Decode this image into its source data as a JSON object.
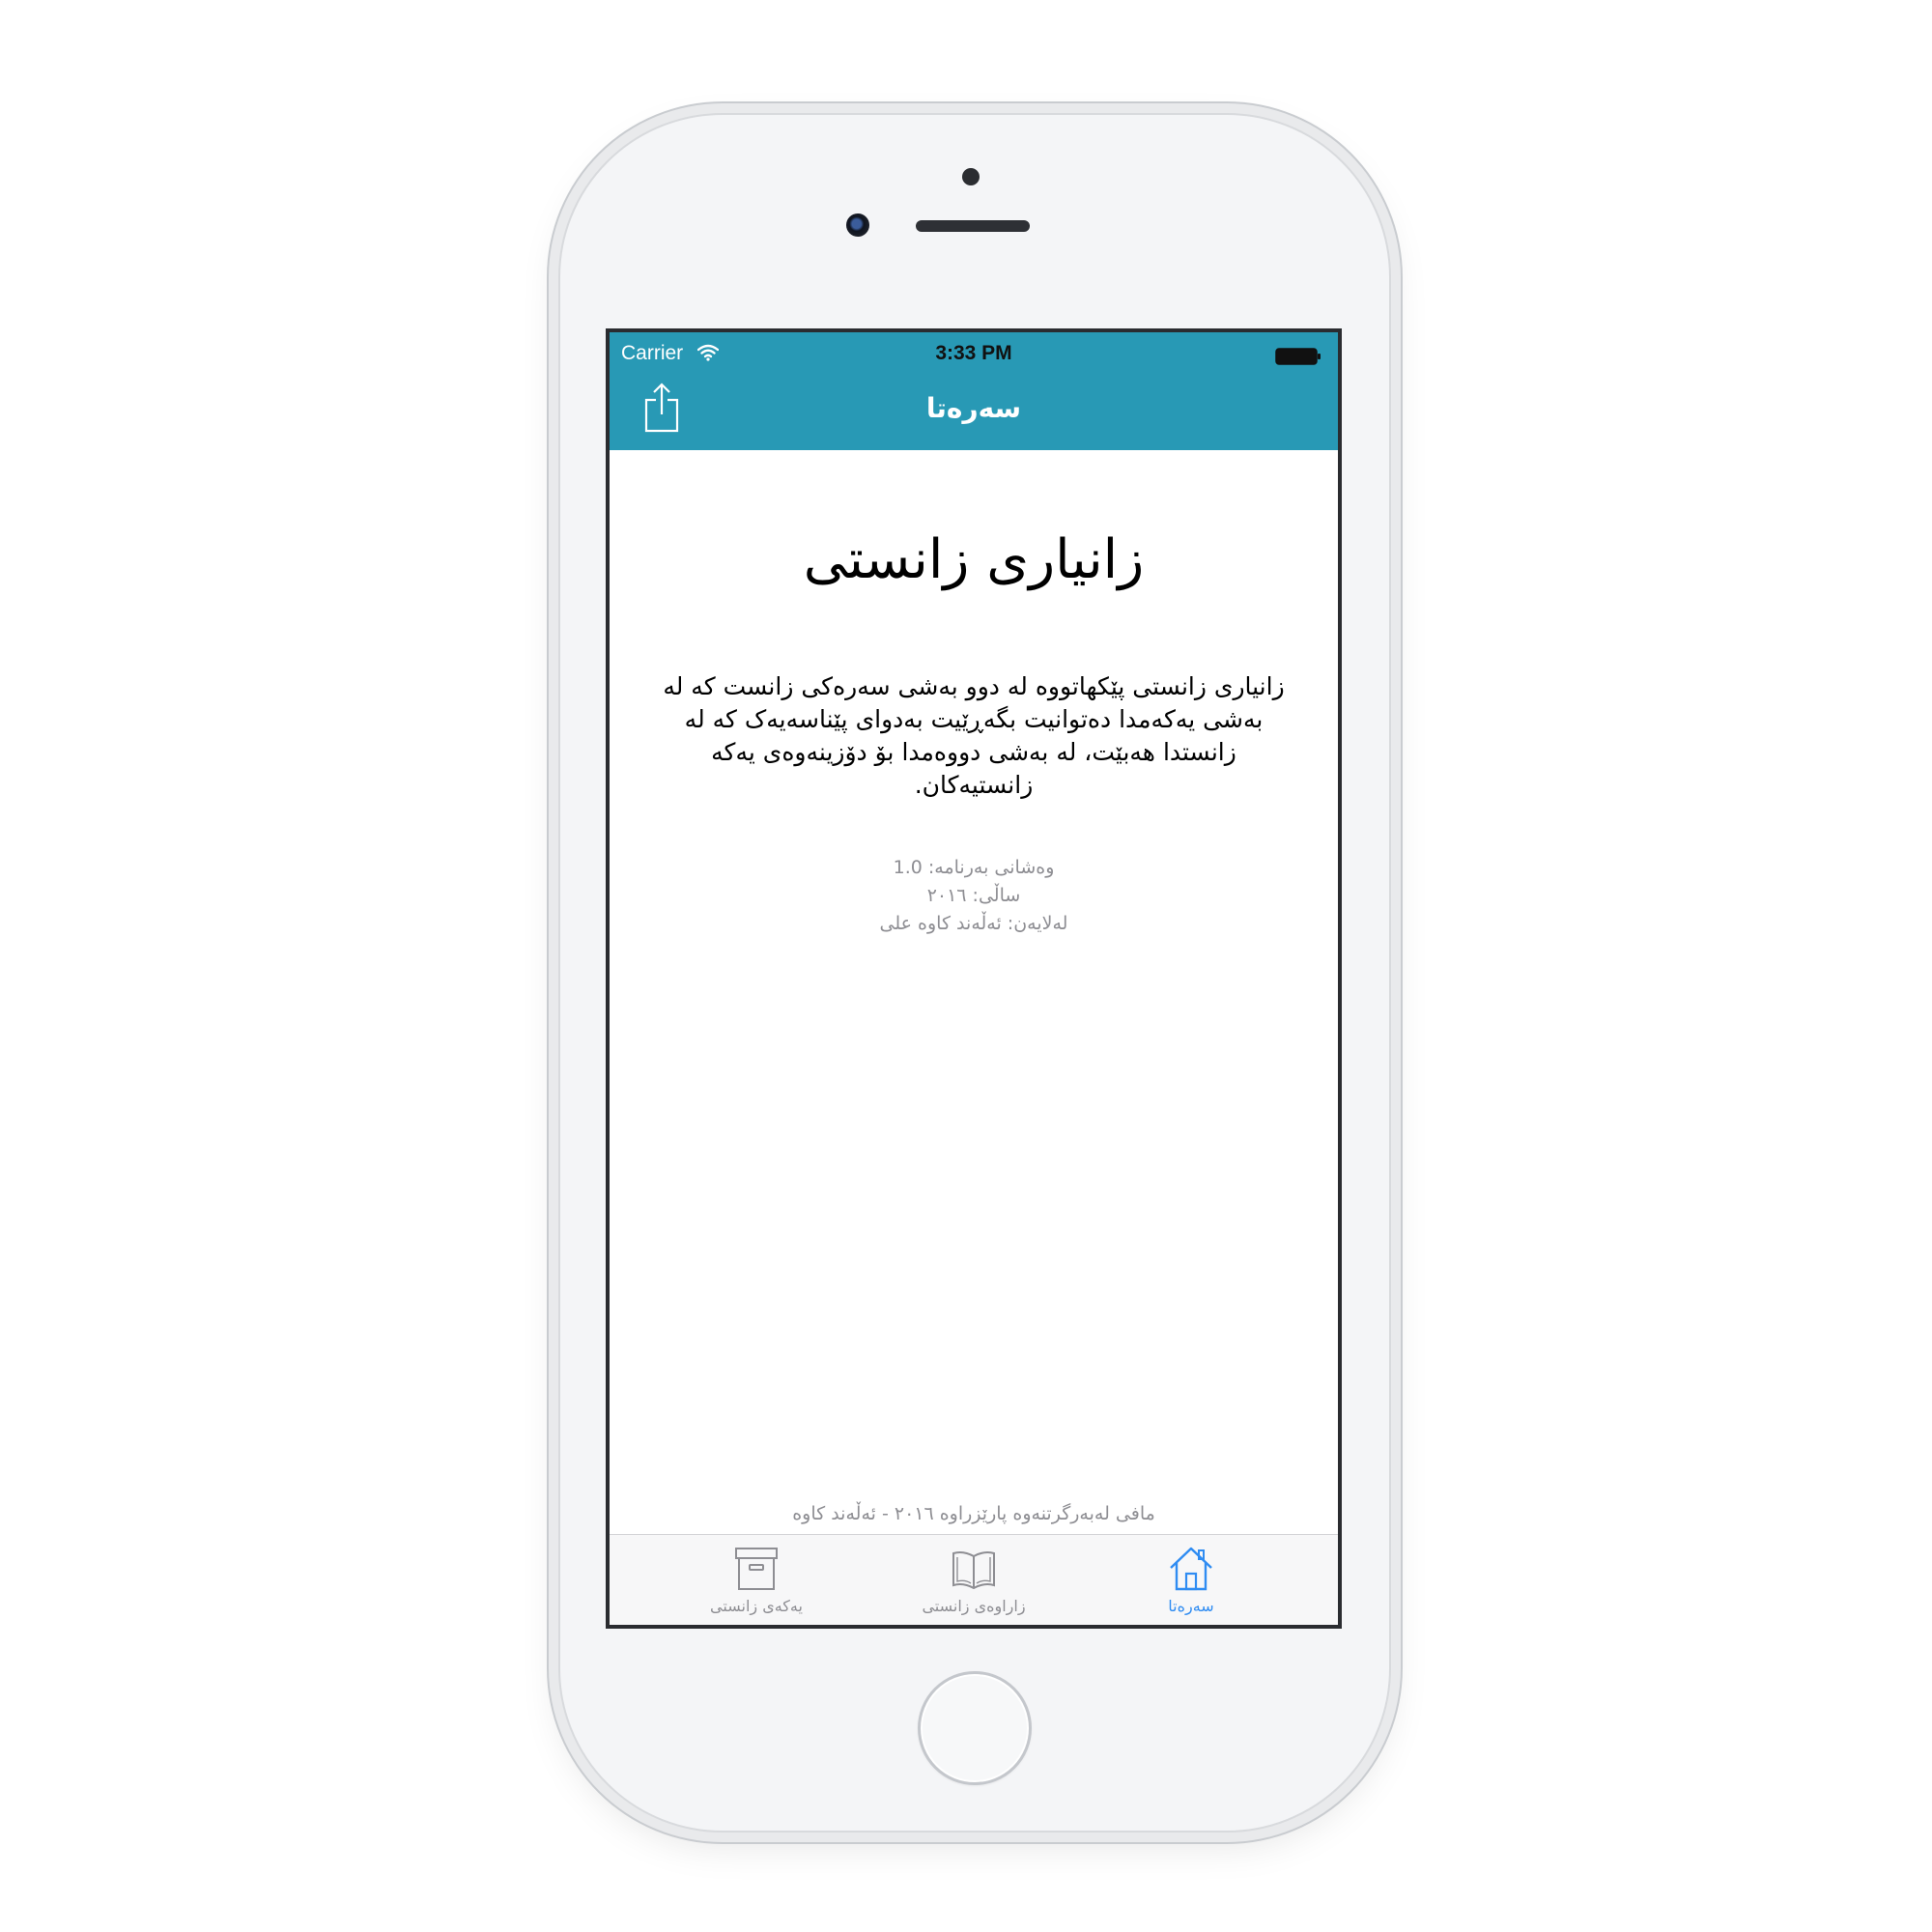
{
  "status_bar": {
    "carrier": "Carrier",
    "time": "3:33 PM"
  },
  "nav": {
    "title": "سەرەتا",
    "share_icon": "share-icon"
  },
  "content": {
    "title": "زانیاری زانستی",
    "description": "زانیاری زانستی پێکهاتووه له دوو بەشی سەرەکی زانست کە له بەشی یەکەمدا دەتوانیت بگەڕێیت بەدوای پێناسەیەک کە لە زانستدا هەبێت، لە بەشی دووەمدا بۆ دۆزینەوەی یەکە زانستیەکان.",
    "version": "وەشانی بەرنامە: 1.0",
    "year": "ساڵی: ٢٠١٦",
    "author": "لەلایەن: ئەڵەند کاوە علی",
    "copyright": "مافی لەبەرگرتنەوە پارێزراوە ٢٠١٦ - ئەڵەند کاوە"
  },
  "tabs": [
    {
      "label": "یەکەی زانستی",
      "icon": "archive-box-icon",
      "active": false
    },
    {
      "label": "زاراوەی زانستی",
      "icon": "open-book-icon",
      "active": false
    },
    {
      "label": "سەرەتا",
      "icon": "home-icon",
      "active": true
    }
  ],
  "colors": {
    "header": "#2899b5",
    "active_tab": "#2f8cf2",
    "inactive_tab": "#8e8e93"
  }
}
